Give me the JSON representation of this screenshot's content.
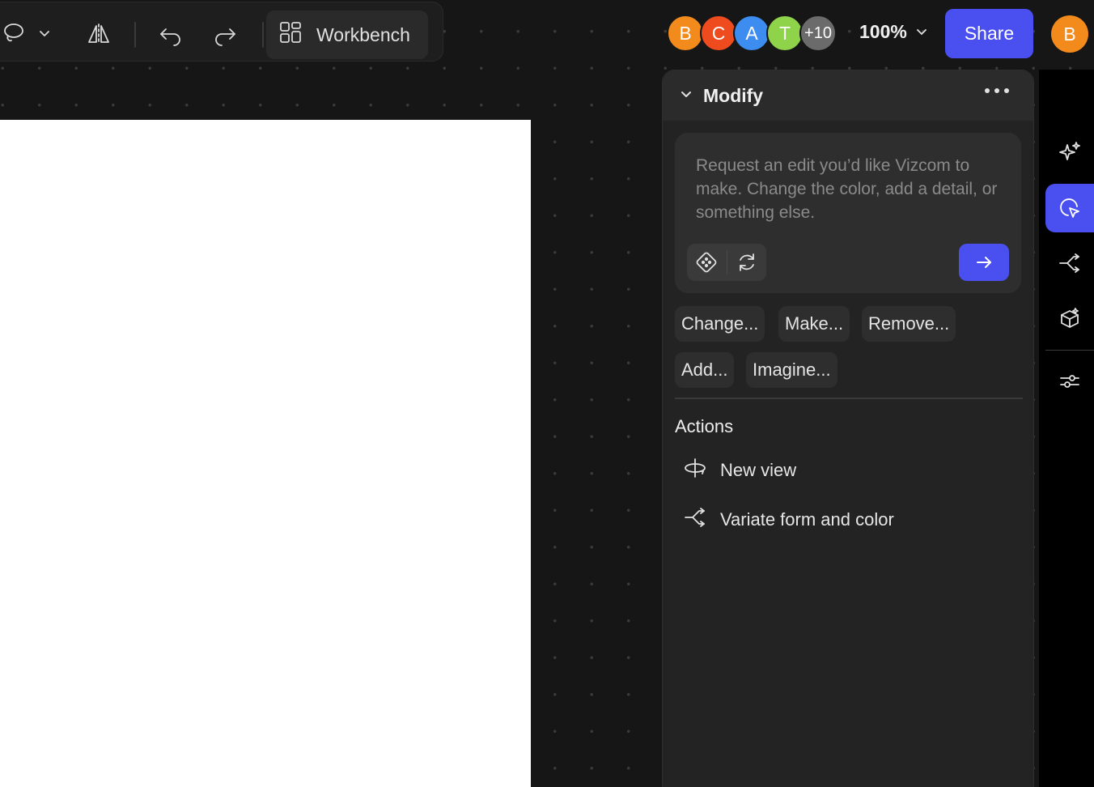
{
  "toolbar": {
    "workbench_label": "Workbench",
    "icons": [
      "lasso-icon",
      "chevron-down-icon",
      "mirror-icon",
      "undo-icon",
      "redo-icon",
      "workbench-icon"
    ]
  },
  "collaborators": {
    "avatars": [
      {
        "initial": "B",
        "color": "#f28a1c"
      },
      {
        "initial": "C",
        "color": "#ee4b1e"
      },
      {
        "initial": "A",
        "color": "#3d8df0"
      },
      {
        "initial": "T",
        "color": "#8fd34a"
      }
    ],
    "overflow": "+10",
    "overflow_color": "#6b6b6b"
  },
  "zoom": {
    "value": "100%"
  },
  "share": {
    "label": "Share",
    "color": "#4a4ff0"
  },
  "user": {
    "initial": "B",
    "color": "#f28a1c"
  },
  "panel": {
    "title": "Modify",
    "prompt_placeholder": "Request an edit you’d like Vizcom to make. Change the color, add a detail, or something else.",
    "chips": [
      "Change...",
      "Make...",
      "Remove...",
      "Add...",
      "Imagine..."
    ],
    "actions_title": "Actions",
    "actions": [
      {
        "label": "New view",
        "icon": "rotate-view-icon"
      },
      {
        "label": "Variate form and color",
        "icon": "branch-icon"
      }
    ]
  },
  "rail": {
    "items": [
      "sparkle-icon",
      "select-edit-icon",
      "branch-icon",
      "cube-icon",
      "adjustments-icon"
    ],
    "active": "select-edit-icon"
  }
}
